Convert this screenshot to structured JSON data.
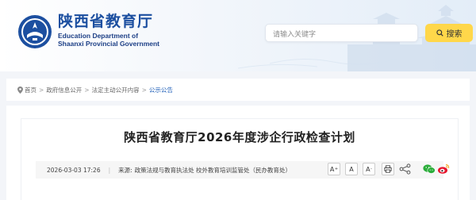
{
  "header": {
    "title_cn": "陕西省教育厅",
    "title_en_line1": "Education Department of",
    "title_en_line2": "Shaanxi Provincial Government",
    "logo_icon": "education-department-emblem",
    "colors": {
      "brand_blue": "#1c4fa0",
      "search_button": "#ffd74a"
    }
  },
  "search": {
    "placeholder": "请输入关键字",
    "button_label": "搜索",
    "icon": "search-icon"
  },
  "breadcrumb": {
    "items": [
      "首页",
      "政府信息公开",
      "法定主动公开内容",
      "公示公告"
    ],
    "separator": ">"
  },
  "article": {
    "title": "陕西省教育厅2026年度涉企行政检查计划",
    "date": "2026-03-03 17:26",
    "source_label": "来源:",
    "source": "政策法规与教育执法处 校外教育培训监管处（民办教育处）",
    "font_buttons": {
      "increase": "A",
      "default": "A",
      "decrease": "A"
    },
    "tools": [
      "print-icon",
      "share-icon",
      "wechat-icon",
      "weibo-icon"
    ]
  }
}
